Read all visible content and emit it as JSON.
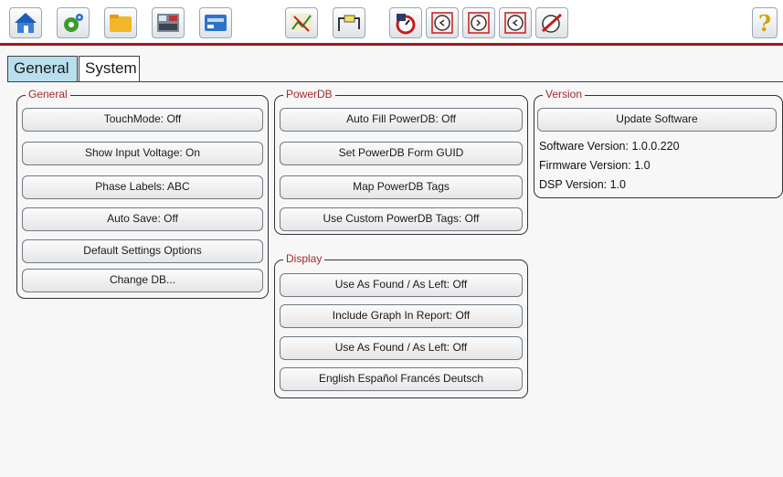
{
  "toolbar": {
    "icons": [
      "home-icon",
      "settings-gear-icon",
      "folder-icon",
      "device-panel-icon",
      "network-card-icon",
      "chart-tool-icon",
      "test-lead-icon",
      "stopwatch-icon",
      "timer-icon",
      "timer-reset-icon",
      "timer-alt-icon",
      "disable-timer-icon",
      "help-icon"
    ],
    "help_label": "?"
  },
  "tabs": [
    {
      "label": "General",
      "active": true
    },
    {
      "label": "System",
      "active": false
    }
  ],
  "general": {
    "title": "General",
    "buttons": [
      "TouchMode: Off",
      "Show Input Voltage: On",
      "Phase Labels: ABC",
      "Auto Save: Off",
      "Default Settings Options",
      "Change DB..."
    ]
  },
  "powerdb": {
    "title": "PowerDB",
    "buttons": [
      "Auto Fill PowerDB: Off",
      "Set PowerDB Form GUID",
      "Map PowerDB Tags",
      "Use Custom PowerDB Tags: Off"
    ]
  },
  "display": {
    "title": "Display",
    "buttons": [
      "Use As Found / As Left: Off",
      "Include Graph In Report: Off",
      "Use As Found / As Left: Off",
      "English Español Francés Deutsch"
    ]
  },
  "version": {
    "title": "Version",
    "update_label": "Update Software",
    "software": "Software Version: 1.0.0.220",
    "firmware": "Firmware Version: 1.0",
    "dsp": "DSP Version:  1.0"
  },
  "colors": {
    "accent_bar": "#9b1c1c",
    "tab_active": "#b9dfee",
    "group_title": "#a52a2a"
  }
}
